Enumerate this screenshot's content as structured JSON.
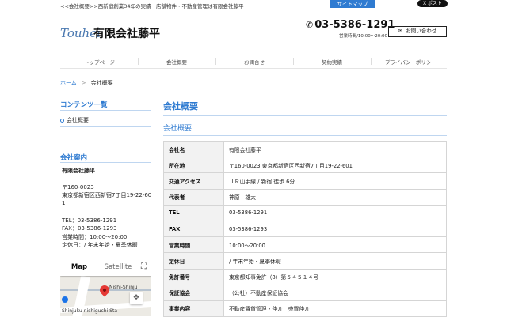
{
  "topbar": {
    "tagline": "<<会社概要>>西新宿創業34年の実績　店舗物件・不動産管理は有限会社藤平",
    "sitemap": "サイトマップ",
    "xpost": "X ポスト"
  },
  "header": {
    "logo_text": "Touhei",
    "company_name": "有限会社藤平",
    "phone_icon": "phone-icon",
    "phone": "03-5386-1291",
    "hours": "営業時間/10:00〜20:00",
    "contact_button": "お問い合わせ"
  },
  "nav": [
    "トップページ",
    "会社概要",
    "お問合せ",
    "契約実績",
    "プライバシーポリシー"
  ],
  "breadcrumb": {
    "home": "ホーム",
    "sep": ">",
    "current": "会社概要"
  },
  "sidebar": {
    "contents_title": "コンテンツ一覧",
    "contents_items": [
      "会社概要"
    ],
    "info_title": "会社案内",
    "info": {
      "name": "有限会社藤平",
      "postal": "〒160-0023",
      "address_1": "東京都新宿区西新宿7丁目19-22-60",
      "address_2": "1",
      "tel": "TEL：03-5386-1291",
      "fax": "FAX：03-5386-1293",
      "hours": "営業時間：10:00〜20:00",
      "holiday": "定休日：/ 年末年始・夏季休暇"
    },
    "map": {
      "tab_map": "Map",
      "tab_satellite": "Satellite",
      "label_1": "Nishi-Shinju",
      "label_2": "Shinjuku-nishiguchi Sta"
    }
  },
  "main": {
    "title": "会社概要",
    "subtitle": "会社概要",
    "rows": [
      {
        "key": "会社名",
        "value": "有限会社藤平"
      },
      {
        "key": "所在地",
        "value": "〒160-0023 東京都新宿区西新宿7丁目19-22-601"
      },
      {
        "key": "交通アクセス",
        "value": "ＪＲ山手線 / 新宿 徒歩 6分"
      },
      {
        "key": "代表者",
        "value": "神原　雄太"
      },
      {
        "key": "TEL",
        "value": "03-5386-1291"
      },
      {
        "key": "FAX",
        "value": "03-5386-1293"
      },
      {
        "key": "営業時間",
        "value": "10:00〜20:00"
      },
      {
        "key": "定休日",
        "value": "/ 年末年始・夏季休暇"
      },
      {
        "key": "免許番号",
        "value": "東京都知事免許（8）第５４５１４号"
      },
      {
        "key": "保証協会",
        "value": "（公社）不動産保証協会"
      },
      {
        "key": "事業内容",
        "value": "不動産賃貸管理・仲介　売買仲介"
      }
    ]
  },
  "colors": {
    "accent": "#2f7bd1",
    "table_key_bg": "#f2f2f2"
  }
}
